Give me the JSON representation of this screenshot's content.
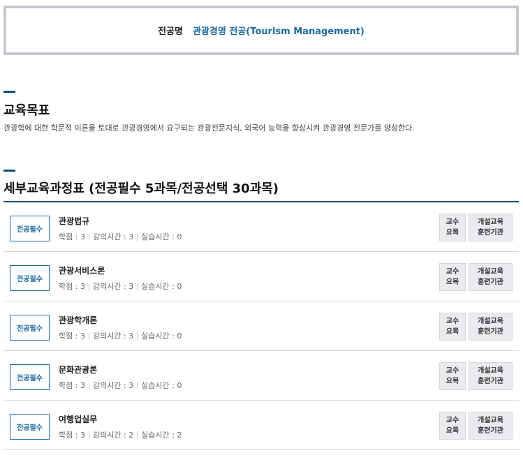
{
  "major": {
    "label": "전공명",
    "name": "관광경영 전공(Tourism Management)"
  },
  "education_goal": {
    "title": "교육목표",
    "text": "관광학에 대한 학문적 이론을 토대로 관광경영에서 요구되는 관광전문지식, 외국어 능력을 향상시켜 관광경영 전문가를 양성한다."
  },
  "curriculum": {
    "title": "세부교육과정표 (전공필수 5과목/전공선택 30과목)",
    "buttons": {
      "syllabus_line1": "교수",
      "syllabus_line2": "요목",
      "institution_line1": "개설교육",
      "institution_line2": "훈련기관"
    },
    "courses": [
      {
        "type": "전공필수",
        "name": "관광법규",
        "credits": "학점 : 3",
        "lecture_hours": "강의시간 : 3",
        "practice_hours": "실습시간 : 0"
      },
      {
        "type": "전공필수",
        "name": "관광서비스론",
        "credits": "학점 : 3",
        "lecture_hours": "강의시간 : 3",
        "practice_hours": "실습시간 : 0"
      },
      {
        "type": "전공필수",
        "name": "관광학개론",
        "credits": "학점 : 3",
        "lecture_hours": "강의시간 : 3",
        "practice_hours": "실습시간 : 0"
      },
      {
        "type": "전공필수",
        "name": "문화관광론",
        "credits": "학점 : 3",
        "lecture_hours": "강의시간 : 3",
        "practice_hours": "실습시간 : 0"
      },
      {
        "type": "전공필수",
        "name": "여행업실무",
        "credits": "학점 : 3",
        "lecture_hours": "강의시간 : 2",
        "practice_hours": "실습시간 : 2"
      }
    ]
  },
  "colors": {
    "accent": "#1a6aa0",
    "section_bar": "#0f4c75",
    "box_border": "#c3c8cf",
    "button_bg": "#e9ebee"
  }
}
